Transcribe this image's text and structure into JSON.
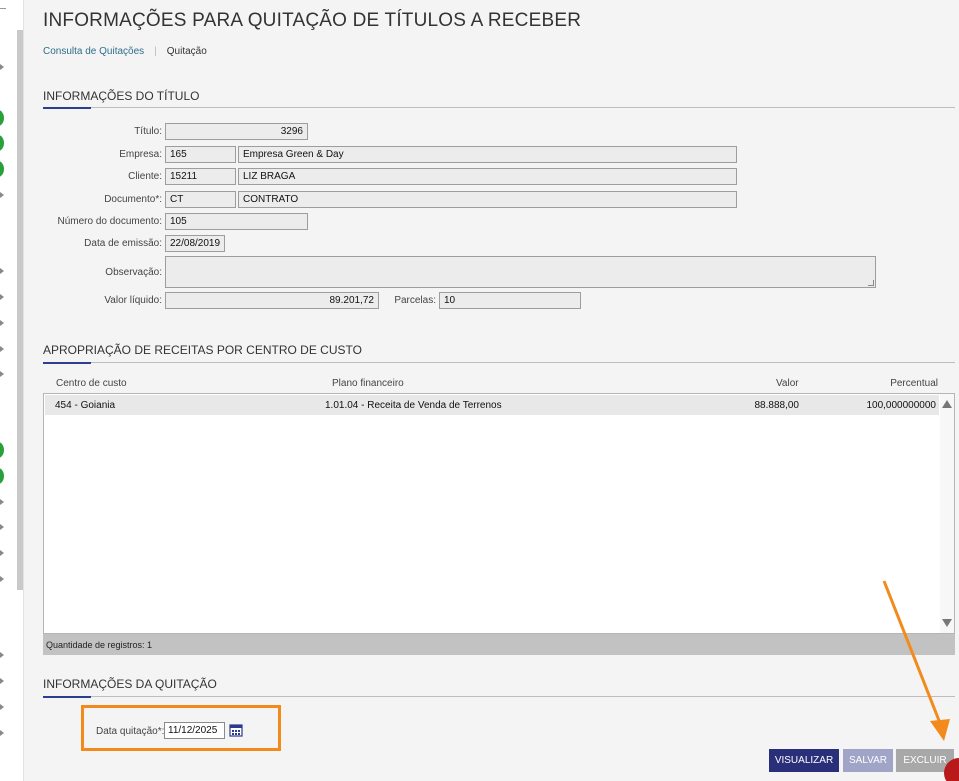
{
  "page": {
    "title": "INFORMAÇÕES PARA QUITAÇÃO DE TÍTULOS A RECEBER",
    "breadcrumb": {
      "link": "Consulta de Quitações",
      "current": "Quitação"
    }
  },
  "titulo_section": {
    "title": "INFORMAÇÕES DO TÍTULO",
    "labels": {
      "titulo": "Título:",
      "empresa": "Empresa:",
      "cliente": "Cliente:",
      "documento": "Documento*:",
      "numero_documento": "Número do documento:",
      "data_emissao": "Data de emissão:",
      "observacao": "Observação:",
      "valor_liquido": "Valor líquido:",
      "parcelas": "Parcelas:"
    },
    "values": {
      "titulo": "3296",
      "empresa_code": "165",
      "empresa_name": "Empresa Green & Day",
      "cliente_code": "15211",
      "cliente_name": "LIZ BRAGA",
      "documento_code": "CT",
      "documento_name": "CONTRATO",
      "numero_documento": "105",
      "data_emissao": "22/08/2019",
      "observacao": "",
      "valor_liquido": "89.201,72",
      "parcelas": "10"
    }
  },
  "apropriacao_section": {
    "title": "APROPRIAÇÃO DE RECEITAS POR CENTRO DE CUSTO",
    "columns": [
      "Centro de custo",
      "Plano financeiro",
      "Valor",
      "Percentual"
    ],
    "rows": [
      {
        "centro": "454 - Goiania",
        "plano": "1.01.04 - Receita de Venda de Terrenos",
        "valor": "88.888,00",
        "percentual": "100,000000000"
      }
    ],
    "footer": "Quantidade de registros: 1"
  },
  "quitacao_section": {
    "title": "INFORMAÇÕES DA QUITAÇÃO",
    "data_label": "Data quitação*:",
    "data_value": "11/12/2025"
  },
  "buttons": {
    "visualizar": "VISUALIZAR",
    "salvar": "SALVAR",
    "excluir": "EXCLUIR"
  },
  "colors": {
    "accent": "#2c3e8f",
    "highlight": "#f28a1c",
    "primary_button": "#2a2f7a"
  }
}
